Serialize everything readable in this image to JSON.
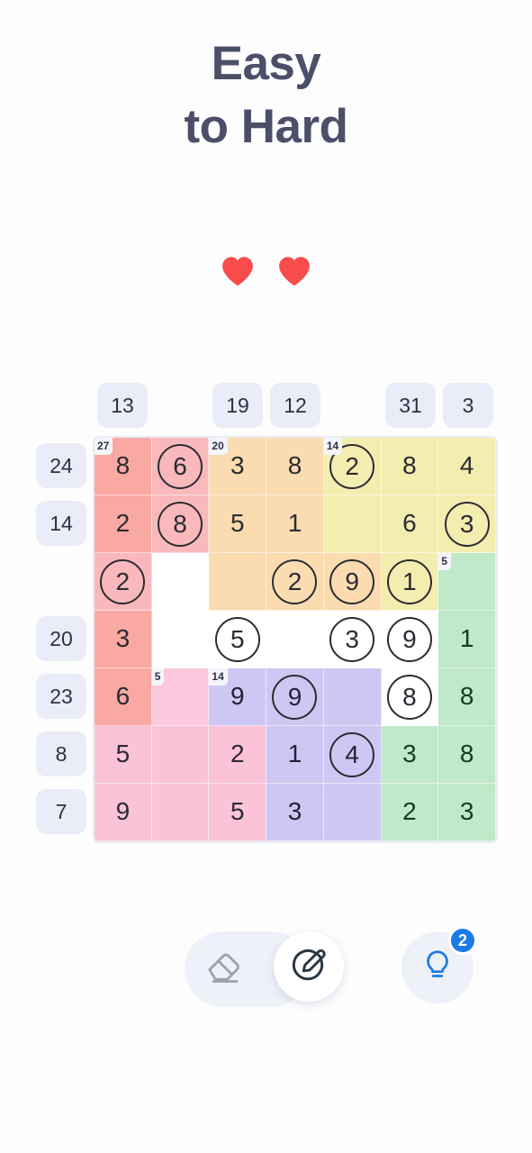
{
  "header": {
    "title_line1": "Easy",
    "title_line2": "to Hard"
  },
  "lives": {
    "count": 2,
    "icon": "heart-icon",
    "color": "#f84b4b"
  },
  "board": {
    "column_clues": [
      "13",
      "",
      "19",
      "12",
      "",
      "31",
      "3"
    ],
    "row_clues": [
      "24",
      "14",
      "",
      "20",
      "23",
      "8",
      "7"
    ],
    "clue_bg": "#eaedf7",
    "cells": [
      [
        {
          "value": "8",
          "color": "salmon",
          "circled": false,
          "cage": "27"
        },
        {
          "value": "6",
          "color": "pinkmid",
          "circled": true,
          "cage": ""
        },
        {
          "value": "3",
          "color": "orange",
          "circled": false,
          "cage": "20"
        },
        {
          "value": "8",
          "color": "orange",
          "circled": false,
          "cage": ""
        },
        {
          "value": "2",
          "color": "yellow",
          "circled": true,
          "cage": "14"
        },
        {
          "value": "8",
          "color": "yellow",
          "circled": false,
          "cage": ""
        },
        {
          "value": "4",
          "color": "yellow",
          "circled": false,
          "cage": ""
        }
      ],
      [
        {
          "value": "2",
          "color": "salmon",
          "circled": false,
          "cage": ""
        },
        {
          "value": "8",
          "color": "pinkmid",
          "circled": true,
          "cage": ""
        },
        {
          "value": "5",
          "color": "orange",
          "circled": false,
          "cage": ""
        },
        {
          "value": "1",
          "color": "orange",
          "circled": false,
          "cage": ""
        },
        {
          "value": "",
          "color": "yellow",
          "circled": false,
          "cage": ""
        },
        {
          "value": "6",
          "color": "yellow",
          "circled": false,
          "cage": ""
        },
        {
          "value": "3",
          "color": "yellow",
          "circled": true,
          "cage": ""
        }
      ],
      [
        {
          "value": "2",
          "color": "pinkmid",
          "circled": true,
          "cage": ""
        },
        {
          "value": "",
          "color": "white",
          "circled": false,
          "cage": ""
        },
        {
          "value": "",
          "color": "orange",
          "circled": false,
          "cage": ""
        },
        {
          "value": "2",
          "color": "orange",
          "circled": true,
          "cage": ""
        },
        {
          "value": "9",
          "color": "orange",
          "circled": true,
          "cage": ""
        },
        {
          "value": "1",
          "color": "yellow",
          "circled": true,
          "cage": ""
        },
        {
          "value": "",
          "color": "green",
          "circled": false,
          "cage": "5"
        }
      ],
      [
        {
          "value": "3",
          "color": "salmon",
          "circled": false,
          "cage": ""
        },
        {
          "value": "",
          "color": "white",
          "circled": false,
          "cage": ""
        },
        {
          "value": "5",
          "color": "white",
          "circled": true,
          "cage": ""
        },
        {
          "value": "",
          "color": "white",
          "circled": false,
          "cage": ""
        },
        {
          "value": "3",
          "color": "white",
          "circled": true,
          "cage": ""
        },
        {
          "value": "9",
          "color": "white",
          "circled": true,
          "cage": ""
        },
        {
          "value": "1",
          "color": "green",
          "circled": false,
          "cage": ""
        }
      ],
      [
        {
          "value": "6",
          "color": "salmon",
          "circled": false,
          "cage": ""
        },
        {
          "value": "",
          "color": "pinklite",
          "circled": false,
          "cage": "5"
        },
        {
          "value": "9",
          "color": "purple",
          "circled": false,
          "cage": "14"
        },
        {
          "value": "9",
          "color": "purple",
          "circled": true,
          "cage": ""
        },
        {
          "value": "",
          "color": "purple",
          "circled": false,
          "cage": ""
        },
        {
          "value": "8",
          "color": "white",
          "circled": true,
          "cage": ""
        },
        {
          "value": "8",
          "color": "green",
          "circled": false,
          "cage": ""
        }
      ],
      [
        {
          "value": "5",
          "color": "pink",
          "circled": false,
          "cage": ""
        },
        {
          "value": "",
          "color": "pink",
          "circled": false,
          "cage": ""
        },
        {
          "value": "2",
          "color": "pink",
          "circled": false,
          "cage": ""
        },
        {
          "value": "1",
          "color": "purple",
          "circled": false,
          "cage": ""
        },
        {
          "value": "4",
          "color": "purple",
          "circled": true,
          "cage": ""
        },
        {
          "value": "3",
          "color": "green",
          "circled": false,
          "cage": ""
        },
        {
          "value": "8",
          "color": "green",
          "circled": false,
          "cage": ""
        }
      ],
      [
        {
          "value": "9",
          "color": "pink",
          "circled": false,
          "cage": ""
        },
        {
          "value": "",
          "color": "pink",
          "circled": false,
          "cage": ""
        },
        {
          "value": "5",
          "color": "pink",
          "circled": false,
          "cage": ""
        },
        {
          "value": "3",
          "color": "purple",
          "circled": false,
          "cage": ""
        },
        {
          "value": "",
          "color": "purple",
          "circled": false,
          "cage": ""
        },
        {
          "value": "2",
          "color": "green",
          "circled": false,
          "cage": ""
        },
        {
          "value": "3",
          "color": "green",
          "circled": false,
          "cage": ""
        }
      ]
    ]
  },
  "toolbar": {
    "eraser_icon": "eraser-icon",
    "pencil_icon": "pencil-edit-icon",
    "pencil_active": true,
    "hint_icon": "lightbulb-icon",
    "hint_count": "2",
    "hint_badge_color": "#1b7ae4",
    "hint_icon_color": "#1b7ae4"
  }
}
